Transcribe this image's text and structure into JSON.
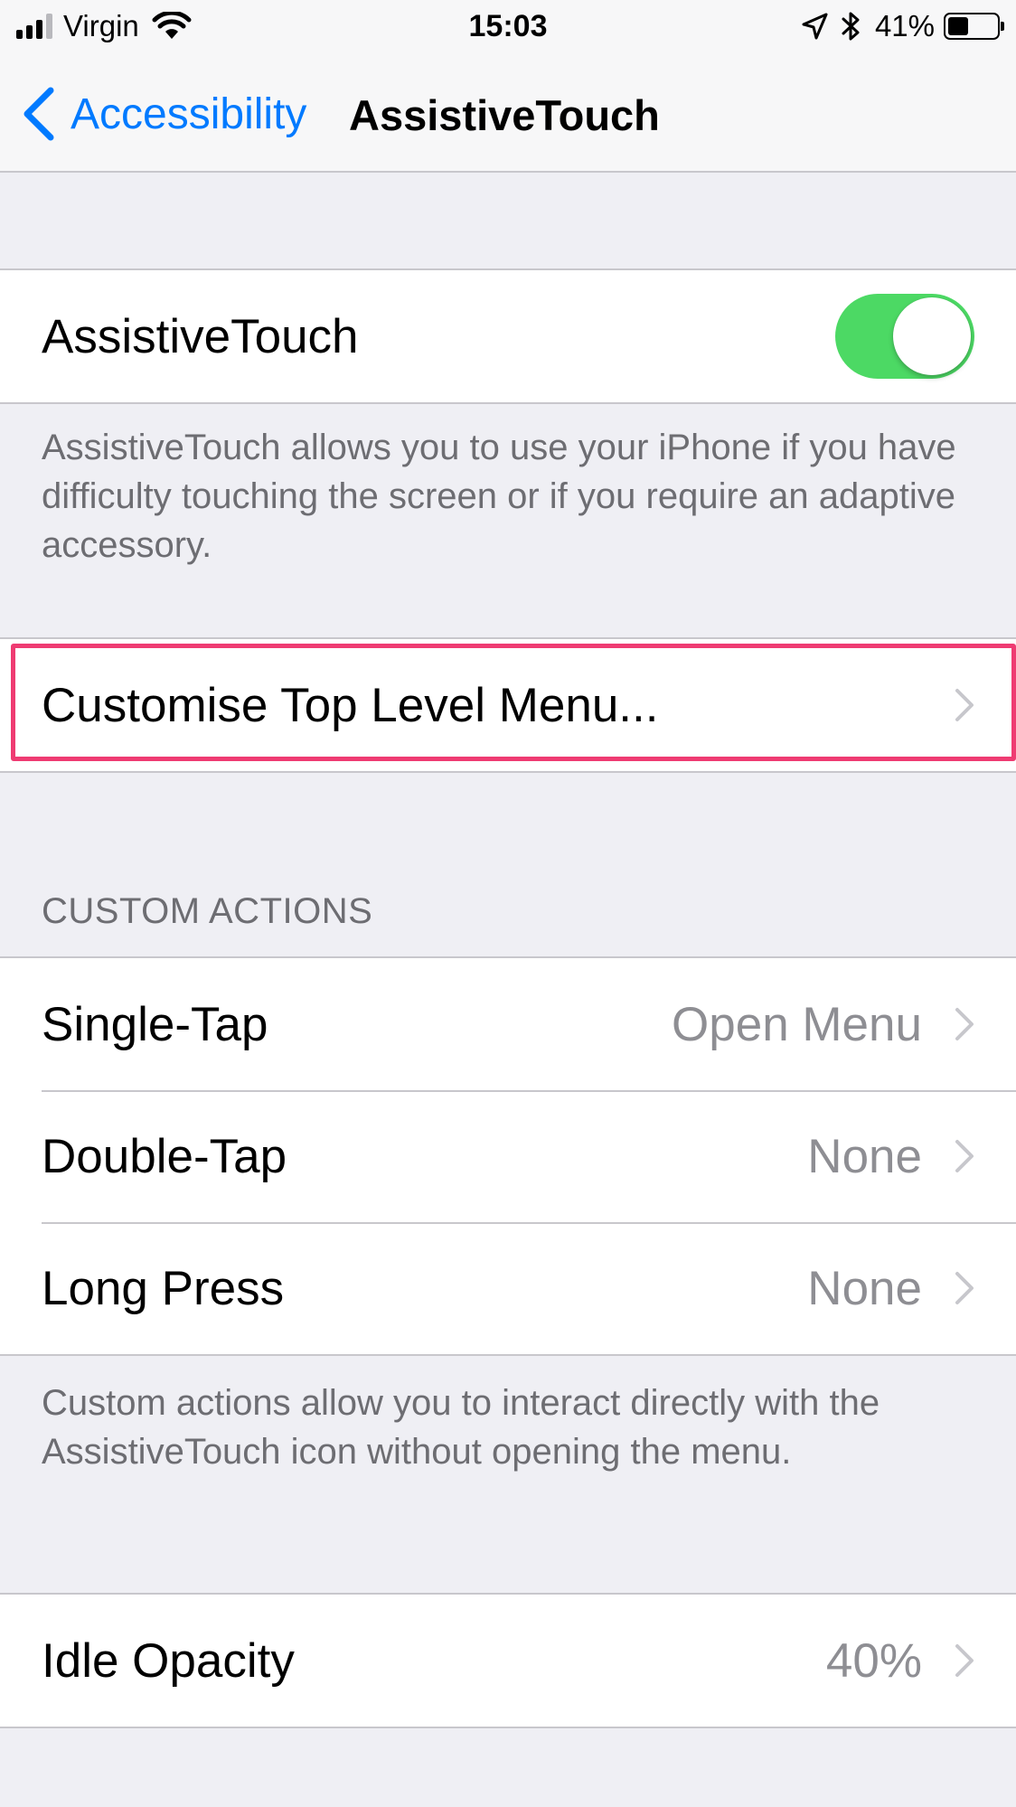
{
  "status_bar": {
    "carrier": "Virgin",
    "time": "15:03",
    "battery_percent": "41%",
    "battery_level": 0.41,
    "icons": [
      "signal-icon",
      "wifi-icon",
      "location-icon",
      "bluetooth-icon",
      "battery-icon"
    ]
  },
  "nav": {
    "back_label": "Accessibility",
    "title": "AssistiveTouch"
  },
  "toggle_section": {
    "label": "AssistiveTouch",
    "enabled": true,
    "footer": "AssistiveTouch allows you to use your iPhone if you have difficulty touching the screen or if you require an adaptive accessory."
  },
  "menu_section": {
    "label": "Customise Top Level Menu..."
  },
  "custom_actions": {
    "header": "CUSTOM ACTIONS",
    "rows": [
      {
        "label": "Single-Tap",
        "value": "Open Menu"
      },
      {
        "label": "Double-Tap",
        "value": "None"
      },
      {
        "label": "Long Press",
        "value": "None"
      }
    ],
    "footer": "Custom actions allow you to interact directly with the AssistiveTouch icon without opening the menu."
  },
  "idle_section": {
    "label": "Idle Opacity",
    "value": "40%"
  },
  "colors": {
    "accent": "#007aff",
    "toggle_on": "#4cd964",
    "highlight": "#ef3b72",
    "background": "#efeff4"
  }
}
